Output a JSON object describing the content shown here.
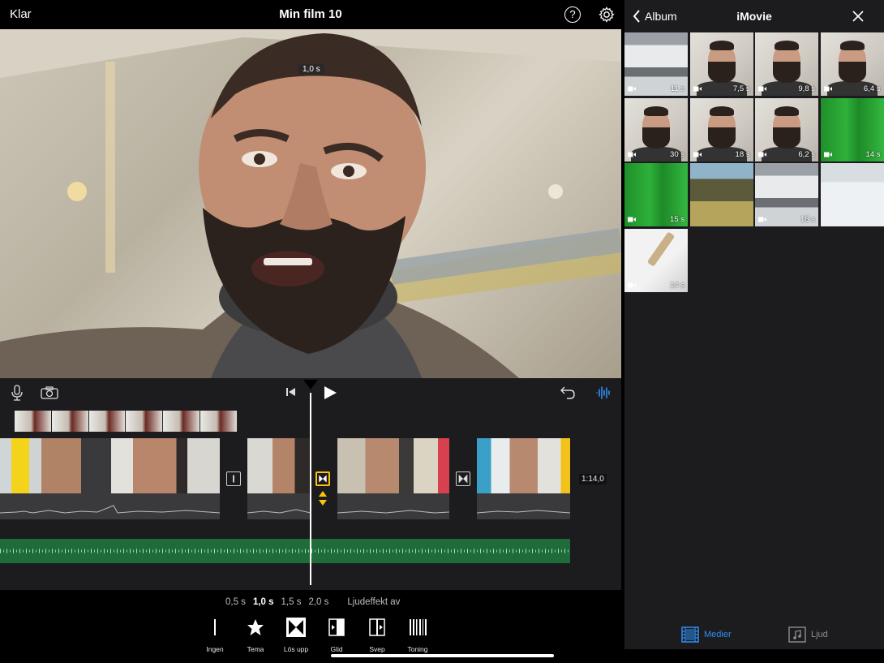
{
  "topbar": {
    "done_label": "Klar",
    "title": "Min film 10"
  },
  "preview": {
    "time_badge": "1,0 s"
  },
  "timeline": {
    "total_duration": "1:14,0"
  },
  "inspector": {
    "durations": [
      "0,5 s",
      "1,0 s",
      "1,5 s",
      "2,0 s"
    ],
    "selected_duration": "1,0 s",
    "sound_effect": "Ljudeffekt av",
    "transitions": [
      {
        "label": "Ingen",
        "icon": "none-transition-icon"
      },
      {
        "label": "Tema",
        "icon": "star-icon"
      },
      {
        "label": "Lös upp",
        "icon": "dissolve-icon"
      },
      {
        "label": "Glid",
        "icon": "slide-icon"
      },
      {
        "label": "Svep",
        "icon": "wipe-icon"
      },
      {
        "label": "Toning",
        "icon": "fade-icon"
      }
    ]
  },
  "panel": {
    "back_label": "Album",
    "title": "iMovie",
    "thumbnails": [
      {
        "duration": "11 s",
        "kind": "gym"
      },
      {
        "duration": "7,5 s",
        "kind": "face"
      },
      {
        "duration": "9,8 s",
        "kind": "face"
      },
      {
        "duration": "6,4 s",
        "kind": "face"
      },
      {
        "duration": "30 s",
        "kind": "face"
      },
      {
        "duration": "18 s",
        "kind": "face"
      },
      {
        "duration": "6,2 s",
        "kind": "face"
      },
      {
        "duration": "14 s",
        "kind": "green"
      },
      {
        "duration": "15 s",
        "kind": "green"
      },
      {
        "duration": "",
        "kind": "forest"
      },
      {
        "duration": "18 s",
        "kind": "gym"
      },
      {
        "duration": "",
        "kind": "snow"
      },
      {
        "duration": "14 s",
        "kind": "pencil"
      }
    ],
    "tabs": {
      "media": "Medier",
      "audio": "Ljud"
    }
  },
  "colors": {
    "accent": "#2e8ff4",
    "selected_transition": "#ffc20e",
    "music_track": "#1f6b3a"
  }
}
